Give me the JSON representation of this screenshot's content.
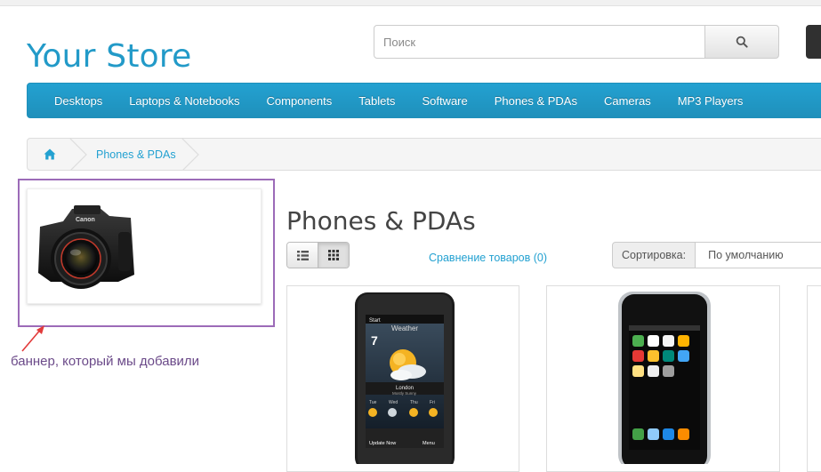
{
  "store": {
    "name": "Your Store"
  },
  "search": {
    "placeholder": "Поиск"
  },
  "menu": {
    "items": [
      {
        "label": "Desktops"
      },
      {
        "label": "Laptops & Notebooks"
      },
      {
        "label": "Components"
      },
      {
        "label": "Tablets"
      },
      {
        "label": "Software"
      },
      {
        "label": "Phones & PDAs"
      },
      {
        "label": "Cameras"
      },
      {
        "label": "MP3 Players"
      }
    ]
  },
  "breadcrumb": {
    "home_icon": "home-icon",
    "current": "Phones & PDAs"
  },
  "banner": {
    "image": "canon-camera",
    "brand": "Canon"
  },
  "annotation": {
    "text": "баннер, который мы добавили"
  },
  "category": {
    "title": "Phones & PDAs"
  },
  "toolbar": {
    "list_icon": "list-view-icon",
    "grid_icon": "grid-view-icon",
    "compare_label": "Сравнение товаров (0)",
    "sort_label": "Сортировка:",
    "sort_value": "По умолчанию"
  },
  "products": [
    {
      "image": "htc-touch-hd-phone",
      "screen": {
        "status": "Start",
        "weather_label": "Weather",
        "time": "7",
        "city": "London",
        "condition": "Mostly Sunny",
        "days": [
          "Tue",
          "Wed",
          "Thu",
          "Fri"
        ],
        "update": "Update Now",
        "menu": "Menu"
      }
    },
    {
      "image": "iphone"
    }
  ],
  "colors": {
    "accent": "#229ac8",
    "menu_bg": "#23a1d1",
    "annotation": "#9c6bb8",
    "annotation_text": "#6b4a89",
    "arrow": "#e23b3b"
  }
}
